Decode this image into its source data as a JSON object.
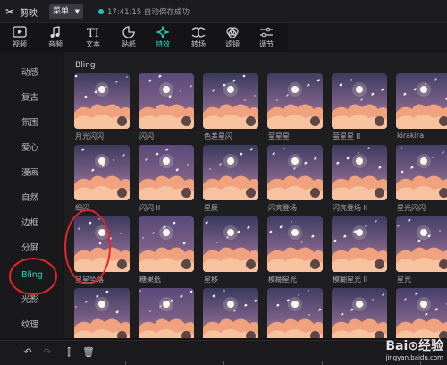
{
  "titlebar": {
    "app_name": "剪映",
    "menu_label": "菜单",
    "save_status": "17:41:15 自动保存成功"
  },
  "toolbar": {
    "items": [
      {
        "label": "视频",
        "icon": "play-icon"
      },
      {
        "label": "音频",
        "icon": "music-note-icon"
      },
      {
        "label": "文本",
        "icon": "text-icon"
      },
      {
        "label": "贴纸",
        "icon": "sticker-icon"
      },
      {
        "label": "特效",
        "icon": "sparkle-icon",
        "active": true
      },
      {
        "label": "转场",
        "icon": "transition-icon"
      },
      {
        "label": "滤镜",
        "icon": "filter-icon"
      },
      {
        "label": "调节",
        "icon": "adjust-icon"
      }
    ]
  },
  "sidebar": {
    "items": [
      "动感",
      "复古",
      "氛围",
      "爱心",
      "漫画",
      "自然",
      "边框",
      "分屏",
      "Bling",
      "光影",
      "纹理"
    ],
    "active": "Bling"
  },
  "content": {
    "section_title": "Bling",
    "effects": [
      "月光闪闪",
      "闪闪",
      "色差星闪",
      "萤星星",
      "萤星星 II",
      "kirakira",
      "细闪",
      "闪闪 II",
      "星辰",
      "闪亮登场",
      "闪亮登场 II",
      "星光闪闪",
      "星星坠落",
      "糖果纸",
      "星移",
      "模糊星光",
      "模糊星光 II",
      "星光",
      "",
      "",
      "",
      "",
      "",
      ""
    ]
  },
  "timeline": {
    "buttons": [
      "undo-icon",
      "redo-icon",
      "split-icon",
      "delete-icon"
    ]
  },
  "watermark": {
    "text": "Bai⊙经验",
    "sub": "jingyan.baidu.com"
  },
  "colors": {
    "accent": "#2fd3c4",
    "annotation": "#e0262c"
  }
}
